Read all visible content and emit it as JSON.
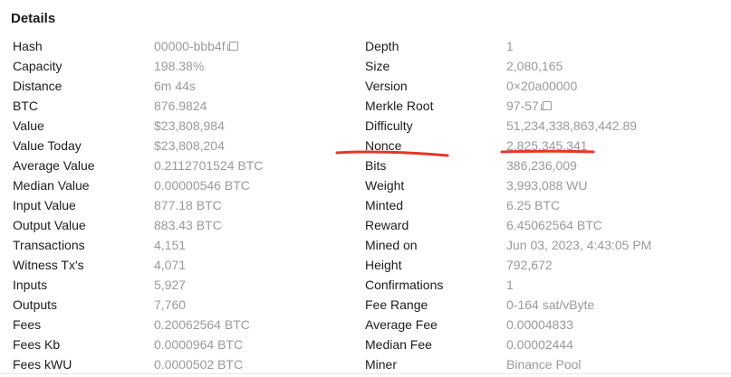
{
  "panel": {
    "title": "Details"
  },
  "left_rows": [
    {
      "label": "Hash",
      "value": "00000-bbb4f",
      "copy": true
    },
    {
      "label": "Capacity",
      "value": "198.38%"
    },
    {
      "label": "Distance",
      "value": "6m 44s"
    },
    {
      "label": "BTC",
      "value": "876.9824"
    },
    {
      "label": "Value",
      "value": "$23,808,984"
    },
    {
      "label": "Value Today",
      "value": "$23,808,204"
    },
    {
      "label": "Average Value",
      "value": "0.2112701524 BTC"
    },
    {
      "label": "Median Value",
      "value": "0.00000546 BTC"
    },
    {
      "label": "Input Value",
      "value": "877.18 BTC"
    },
    {
      "label": "Output Value",
      "value": "883.43 BTC"
    },
    {
      "label": "Transactions",
      "value": "4,151"
    },
    {
      "label": "Witness Tx's",
      "value": "4,071"
    },
    {
      "label": "Inputs",
      "value": "5,927"
    },
    {
      "label": "Outputs",
      "value": "7,760"
    },
    {
      "label": "Fees",
      "value": "0.20062564 BTC"
    },
    {
      "label": "Fees Kb",
      "value": "0.0000964 BTC"
    },
    {
      "label": "Fees kWU",
      "value": "0.0000502 BTC"
    }
  ],
  "right_rows": [
    {
      "label": "Depth",
      "value": "1"
    },
    {
      "label": "Size",
      "value": "2,080,165"
    },
    {
      "label": "Version",
      "value": "0×20a00000"
    },
    {
      "label": "Merkle Root",
      "value": "97-57",
      "copy": true
    },
    {
      "label": "Difficulty",
      "value": "51,234,338,863,442.89"
    },
    {
      "label": "Nonce",
      "value": "2,825,345,341",
      "highlight": true
    },
    {
      "label": "Bits",
      "value": "386,236,009"
    },
    {
      "label": "Weight",
      "value": "3,993,088 WU"
    },
    {
      "label": "Minted",
      "value": "6.25 BTC"
    },
    {
      "label": "Reward",
      "value": "6.45062564 BTC"
    },
    {
      "label": "Mined on",
      "value": "Jun 03, 2023, 4:43:05 PM"
    },
    {
      "label": "Height",
      "value": "792,672"
    },
    {
      "label": "Confirmations",
      "value": "1"
    },
    {
      "label": "Fee Range",
      "value": "0-164 sat/vByte"
    },
    {
      "label": "Average Fee",
      "value": "0.00004833"
    },
    {
      "label": "Median Fee",
      "value": "0.00002444"
    },
    {
      "label": "Miner",
      "value": "Binance Pool"
    }
  ],
  "annotation": {
    "color": "#e8342a"
  },
  "icons": {
    "copy": "copy-icon"
  }
}
